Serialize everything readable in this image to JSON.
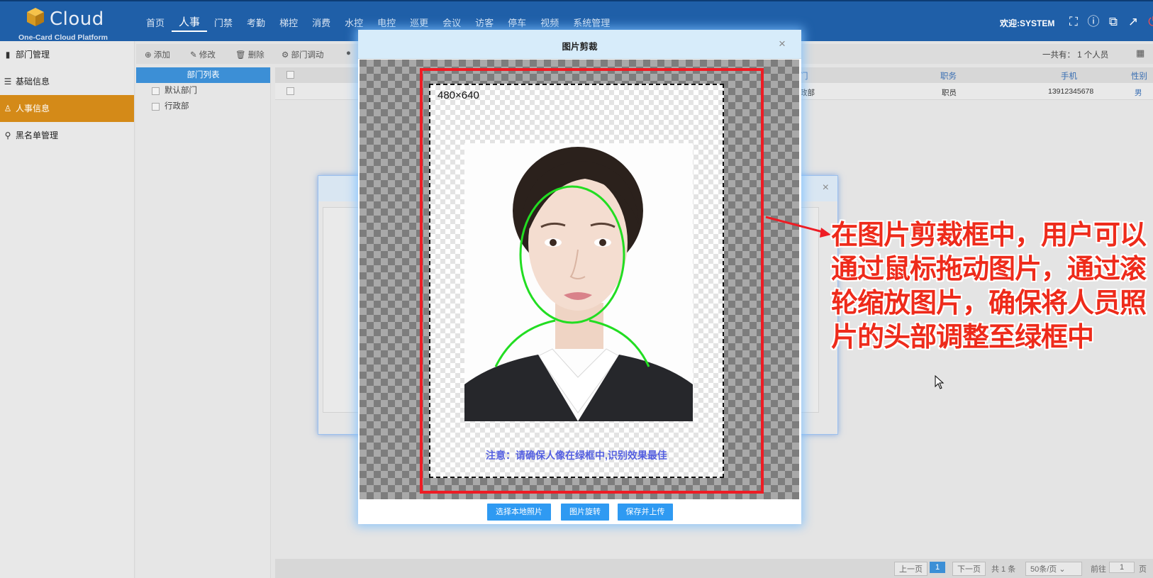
{
  "header": {
    "logo_word": "Cloud",
    "logo_sub": "One-Card Cloud Platform",
    "nav": [
      "首页",
      "人事",
      "门禁",
      "考勤",
      "梯控",
      "消费",
      "水控",
      "电控",
      "巡更",
      "会议",
      "访客",
      "停车",
      "视频",
      "系统管理"
    ],
    "welcome": "欢迎:SYSTEM"
  },
  "sidebar": {
    "items": [
      {
        "label": "部门管理",
        "icon": "people-icon"
      },
      {
        "label": "基础信息",
        "icon": "list-icon"
      },
      {
        "label": "人事信息",
        "icon": "person-icon"
      },
      {
        "label": "黑名单管理",
        "icon": "blacklist-icon"
      }
    ]
  },
  "toolbar": {
    "add": "添加",
    "edit": "修改",
    "delete": "删除",
    "transfer": "部门调动",
    "total_label": "一共有：",
    "total_value": "1 个人员"
  },
  "dept": {
    "header": "部门列表",
    "items": [
      "默认部门",
      "行政部"
    ]
  },
  "table": {
    "headers": {
      "dept": "门",
      "position": "职务",
      "phone": "手机",
      "gender": "性别"
    },
    "row": {
      "dept": "政部",
      "position": "职员",
      "phone": "13912345678",
      "gender": "男"
    }
  },
  "pager": {
    "prev": "上一页",
    "current": "1",
    "next": "下一页",
    "total": "共 1 条",
    "per_page": "50条/页",
    "goto": "前往",
    "goto_value": "1",
    "page_suffix": "页"
  },
  "modal": {
    "title": "图片剪裁",
    "size_label": "480×640",
    "notice": "注意：请确保人像在绿框中,识别效果最佳",
    "buttons": {
      "choose": "选择本地照片",
      "rotate": "图片旋转",
      "save": "保存并上传"
    }
  },
  "annotation": {
    "lines": [
      "在图片剪裁框中，用户可以",
      "通过鼠标拖动图片，通过滚",
      "轮缩放图片，确保将人员照",
      "片的头部调整至绿框中"
    ]
  },
  "colors": {
    "topbar": "#1f5fa8",
    "sidebar_active": "#d48a18",
    "frame_red": "#ee1c24",
    "face_guide": "#22dd22",
    "button_blue": "#2f9af2",
    "annotation_red": "#ee2b1b"
  }
}
